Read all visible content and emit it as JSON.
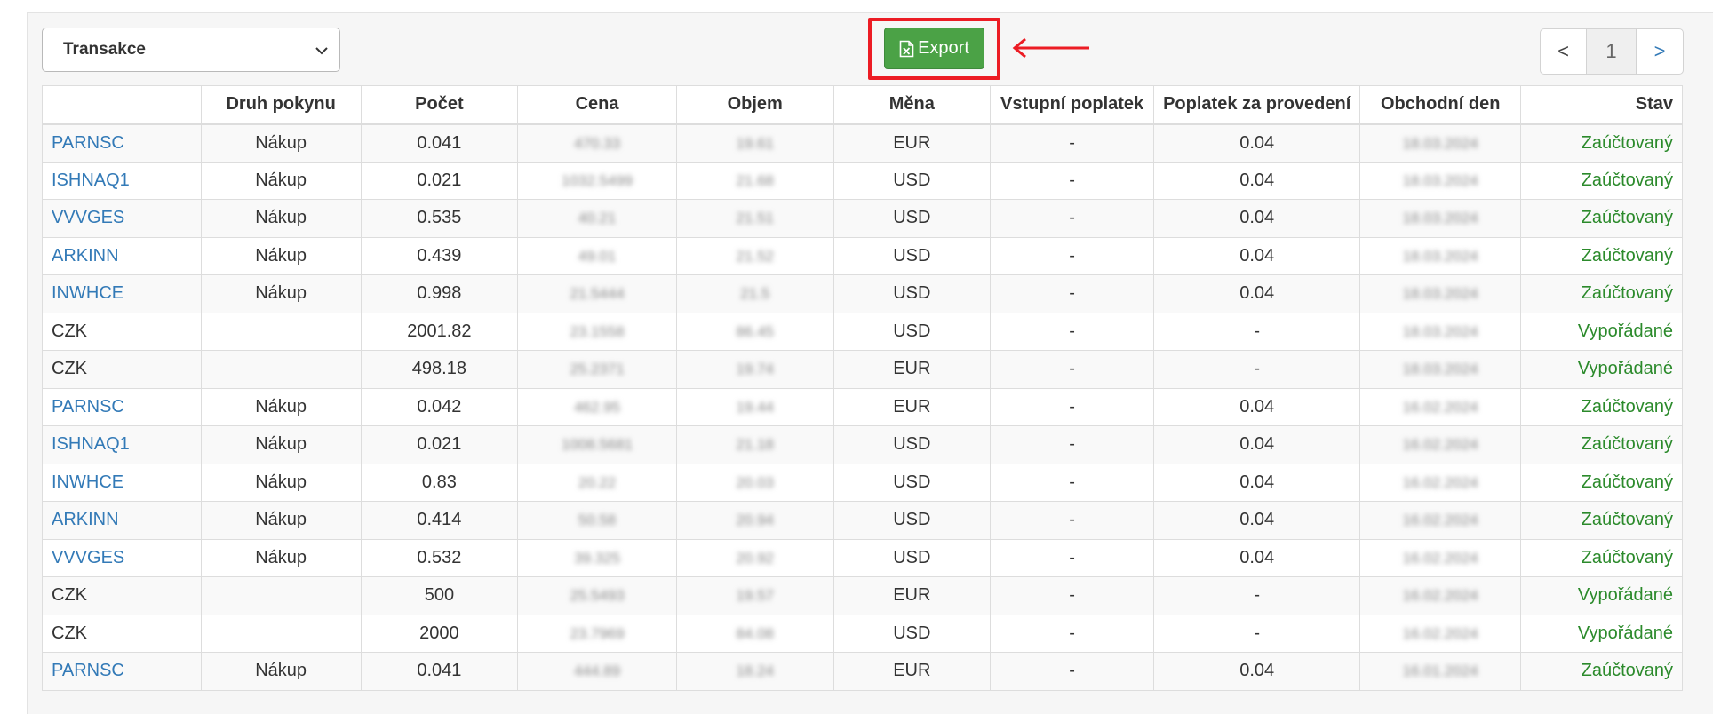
{
  "filter": {
    "selected": "Transakce"
  },
  "toolbar": {
    "export_label": "Export"
  },
  "pager": {
    "prev": "<",
    "current": "1",
    "next": ">"
  },
  "table": {
    "headers": [
      "",
      "Druh pokynu",
      "Počet",
      "Cena",
      "Objem",
      "Měna",
      "Vstupní poplatek",
      "Poplatek za provedení",
      "Obchodní den",
      "Stav"
    ],
    "rows": [
      {
        "symbol": "PARNSC",
        "link": true,
        "druh": "Nákup",
        "pocet": "0.041",
        "cena": "470.33",
        "objem": "19.61",
        "mena": "EUR",
        "vstup": "-",
        "poplatek": "0.04",
        "den": "18.03.2024",
        "stav": "Zaúčtovaný"
      },
      {
        "symbol": "ISHNAQ1",
        "link": true,
        "druh": "Nákup",
        "pocet": "0.021",
        "cena": "1032.5499",
        "objem": "21.68",
        "mena": "USD",
        "vstup": "-",
        "poplatek": "0.04",
        "den": "18.03.2024",
        "stav": "Zaúčtovaný"
      },
      {
        "symbol": "VVVGES",
        "link": true,
        "druh": "Nákup",
        "pocet": "0.535",
        "cena": "40.21",
        "objem": "21.51",
        "mena": "USD",
        "vstup": "-",
        "poplatek": "0.04",
        "den": "18.03.2024",
        "stav": "Zaúčtovaný"
      },
      {
        "symbol": "ARKINN",
        "link": true,
        "druh": "Nákup",
        "pocet": "0.439",
        "cena": "49.01",
        "objem": "21.52",
        "mena": "USD",
        "vstup": "-",
        "poplatek": "0.04",
        "den": "18.03.2024",
        "stav": "Zaúčtovaný"
      },
      {
        "symbol": "INWHCE",
        "link": true,
        "druh": "Nákup",
        "pocet": "0.998",
        "cena": "21.5444",
        "objem": "21.5",
        "mena": "USD",
        "vstup": "-",
        "poplatek": "0.04",
        "den": "18.03.2024",
        "stav": "Zaúčtovaný"
      },
      {
        "symbol": "CZK",
        "link": false,
        "druh": "",
        "pocet": "2001.82",
        "cena": "23.1558",
        "objem": "86.45",
        "mena": "USD",
        "vstup": "-",
        "poplatek": "-",
        "den": "18.03.2024",
        "stav": "Vypořádané"
      },
      {
        "symbol": "CZK",
        "link": false,
        "druh": "",
        "pocet": "498.18",
        "cena": "25.2371",
        "objem": "19.74",
        "mena": "EUR",
        "vstup": "-",
        "poplatek": "-",
        "den": "18.03.2024",
        "stav": "Vypořádané"
      },
      {
        "symbol": "PARNSC",
        "link": true,
        "druh": "Nákup",
        "pocet": "0.042",
        "cena": "462.95",
        "objem": "19.44",
        "mena": "EUR",
        "vstup": "-",
        "poplatek": "0.04",
        "den": "16.02.2024",
        "stav": "Zaúčtovaný"
      },
      {
        "symbol": "ISHNAQ1",
        "link": true,
        "druh": "Nákup",
        "pocet": "0.021",
        "cena": "1008.5681",
        "objem": "21.18",
        "mena": "USD",
        "vstup": "-",
        "poplatek": "0.04",
        "den": "16.02.2024",
        "stav": "Zaúčtovaný"
      },
      {
        "symbol": "INWHCE",
        "link": true,
        "druh": "Nákup",
        "pocet": "0.83",
        "cena": "20.22",
        "objem": "20.03",
        "mena": "USD",
        "vstup": "-",
        "poplatek": "0.04",
        "den": "16.02.2024",
        "stav": "Zaúčtovaný"
      },
      {
        "symbol": "ARKINN",
        "link": true,
        "druh": "Nákup",
        "pocet": "0.414",
        "cena": "50.58",
        "objem": "20.94",
        "mena": "USD",
        "vstup": "-",
        "poplatek": "0.04",
        "den": "16.02.2024",
        "stav": "Zaúčtovaný"
      },
      {
        "symbol": "VVVGES",
        "link": true,
        "druh": "Nákup",
        "pocet": "0.532",
        "cena": "39.325",
        "objem": "20.92",
        "mena": "USD",
        "vstup": "-",
        "poplatek": "0.04",
        "den": "16.02.2024",
        "stav": "Zaúčtovaný"
      },
      {
        "symbol": "CZK",
        "link": false,
        "druh": "",
        "pocet": "500",
        "cena": "25.5493",
        "objem": "19.57",
        "mena": "EUR",
        "vstup": "-",
        "poplatek": "-",
        "den": "16.02.2024",
        "stav": "Vypořádané"
      },
      {
        "symbol": "CZK",
        "link": false,
        "druh": "",
        "pocet": "2000",
        "cena": "23.7969",
        "objem": "84.08",
        "mena": "USD",
        "vstup": "-",
        "poplatek": "-",
        "den": "16.02.2024",
        "stav": "Vypořádané"
      },
      {
        "symbol": "PARNSC",
        "link": true,
        "druh": "Nákup",
        "pocet": "0.041",
        "cena": "444.89",
        "objem": "18.24",
        "mena": "EUR",
        "vstup": "-",
        "poplatek": "0.04",
        "den": "16.01.2024",
        "stav": "Zaúčtovaný"
      }
    ]
  },
  "colors": {
    "export_button": "#4ba246",
    "highlight": "#ec1c24",
    "link": "#337ab7",
    "status": "#2b8a2b"
  }
}
